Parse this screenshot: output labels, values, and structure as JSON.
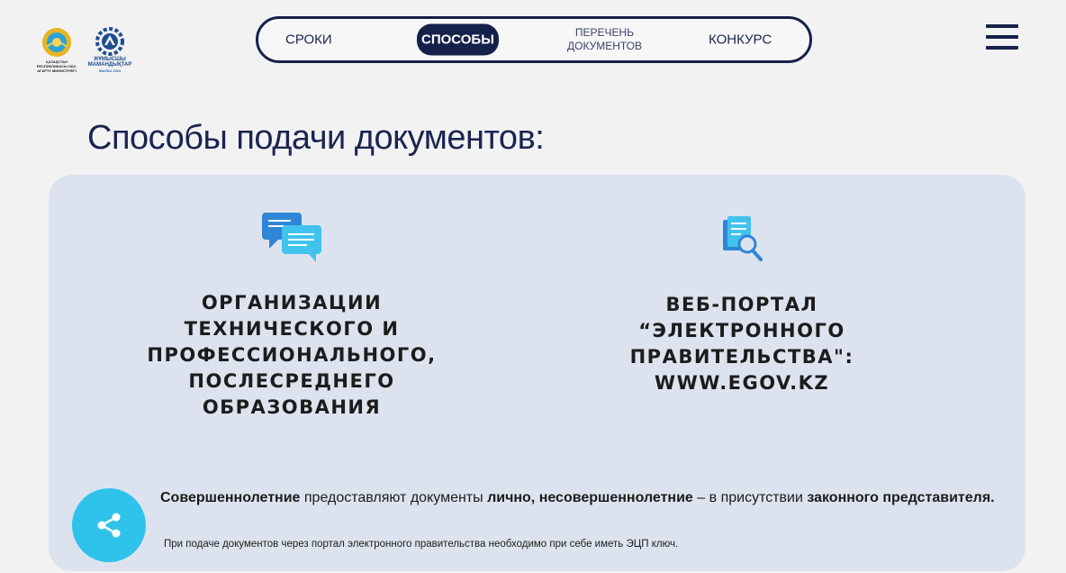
{
  "header": {
    "logo_kz_caption": "ҚАЗАҚСТАН РЕСПУБЛИКАСЫ ОҚУ-АҒАРТУ МИНИСТРЛІГІ",
    "logo_zh_caption": "ЖҰМЫСШЫ МАМАНДЫҚТАР",
    "logo_zh_caption2": "ЖЫЛЫ 2023",
    "nav": {
      "sroki": "СРОКИ",
      "sposoby": "СПОСОБЫ",
      "perechen_line1": "ПЕРЕЧЕНЬ",
      "perechen_line2": "ДОКУМЕНТОВ",
      "konkurs": "КОНКУРС"
    }
  },
  "page_title": "Способы подачи документов:",
  "methods": [
    {
      "icon": "chat-bubbles-icon",
      "lines": [
        "ОРГАНИЗАЦИИ",
        "ТЕХНИЧЕСКОГО И",
        "ПРОФЕССИОНАЛЬНОГО,",
        "ПОСЛЕСРЕДНЕГО",
        "ОБРАЗОВАНИЯ"
      ]
    },
    {
      "icon": "document-search-icon",
      "lines": [
        "ВЕБ-ПОРТАЛ",
        "“ЭЛЕКТРОННОГО",
        "ПРАВИТЕЛЬСТВА\":",
        "WWW.EGOV.KZ"
      ]
    }
  ],
  "note": {
    "part1": "Совершеннолетние",
    "part2": " предоставляют документы ",
    "part3": "лично, несовершеннолетние",
    "part4": " – в присутствии ",
    "part5": "законного представителя."
  },
  "subnote": "При подаче документов через портал электронного правительства необходимо при себе иметь ЭЦП ключ.",
  "colors": {
    "navy": "#16214a",
    "card_bg": "#dde3ee",
    "share_button": "#2fc3ec"
  }
}
